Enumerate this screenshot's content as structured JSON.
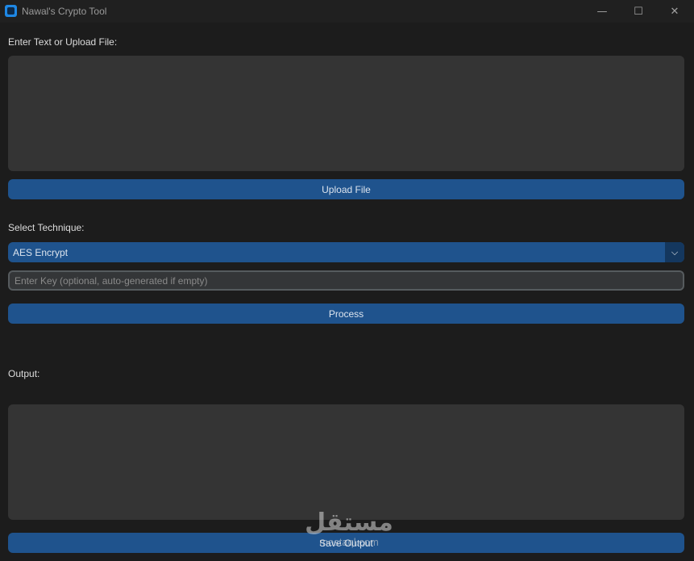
{
  "window": {
    "title": "Nawal's Crypto Tool",
    "controls": {
      "minimize": "—",
      "maximize": "☐",
      "close": "✕"
    }
  },
  "input_section": {
    "label": "Enter Text or Upload File:",
    "text_value": "",
    "upload_button": "Upload File"
  },
  "technique": {
    "label": "Select Technique:",
    "selected": "AES Encrypt",
    "arrow_icon": "chevron-down-icon"
  },
  "key": {
    "value": "",
    "placeholder": "Enter Key (optional, auto-generated if empty)"
  },
  "process_button": "Process",
  "output_section": {
    "label": "Output:",
    "text_value": "",
    "save_button": "Save Output"
  },
  "watermark": {
    "arabic": "مستقل",
    "latin": "mostaql.com"
  },
  "colors": {
    "background": "#1c1c1c",
    "button": "#1f538d",
    "textbox": "#343434",
    "app_icon": "#1e88e5"
  }
}
